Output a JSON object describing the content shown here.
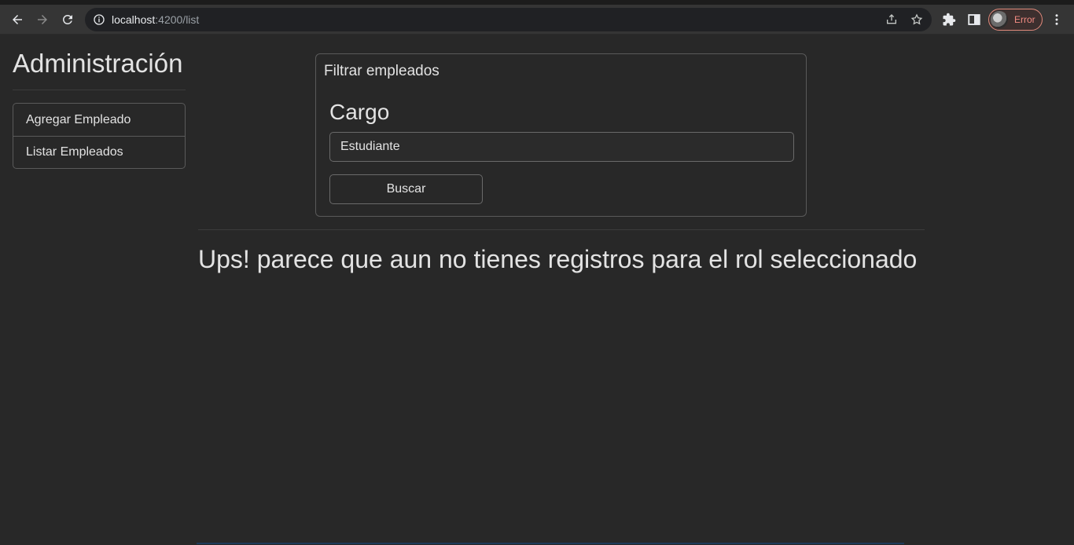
{
  "browser": {
    "url_host": "localhost",
    "url_path": ":4200/list",
    "profile_label": "Error",
    "colors": {
      "toolbar": "#353535",
      "omnibox": "#202124",
      "profile_error": "#f28b82"
    }
  },
  "sidebar": {
    "title": "Administración",
    "items": [
      {
        "label": "Agregar Empleado"
      },
      {
        "label": "Listar Empleados"
      }
    ]
  },
  "filter": {
    "title": "Filtrar empleados",
    "field_label": "Cargo",
    "field_value": "Estudiante",
    "button_label": "Buscar"
  },
  "main": {
    "empty_message": "Ups! parece que aun no tienes registros para el rol seleccionado"
  },
  "page": {
    "colors": {
      "background": "#282828",
      "text": "#e3e3e3",
      "border": "#5a5a5a"
    }
  }
}
